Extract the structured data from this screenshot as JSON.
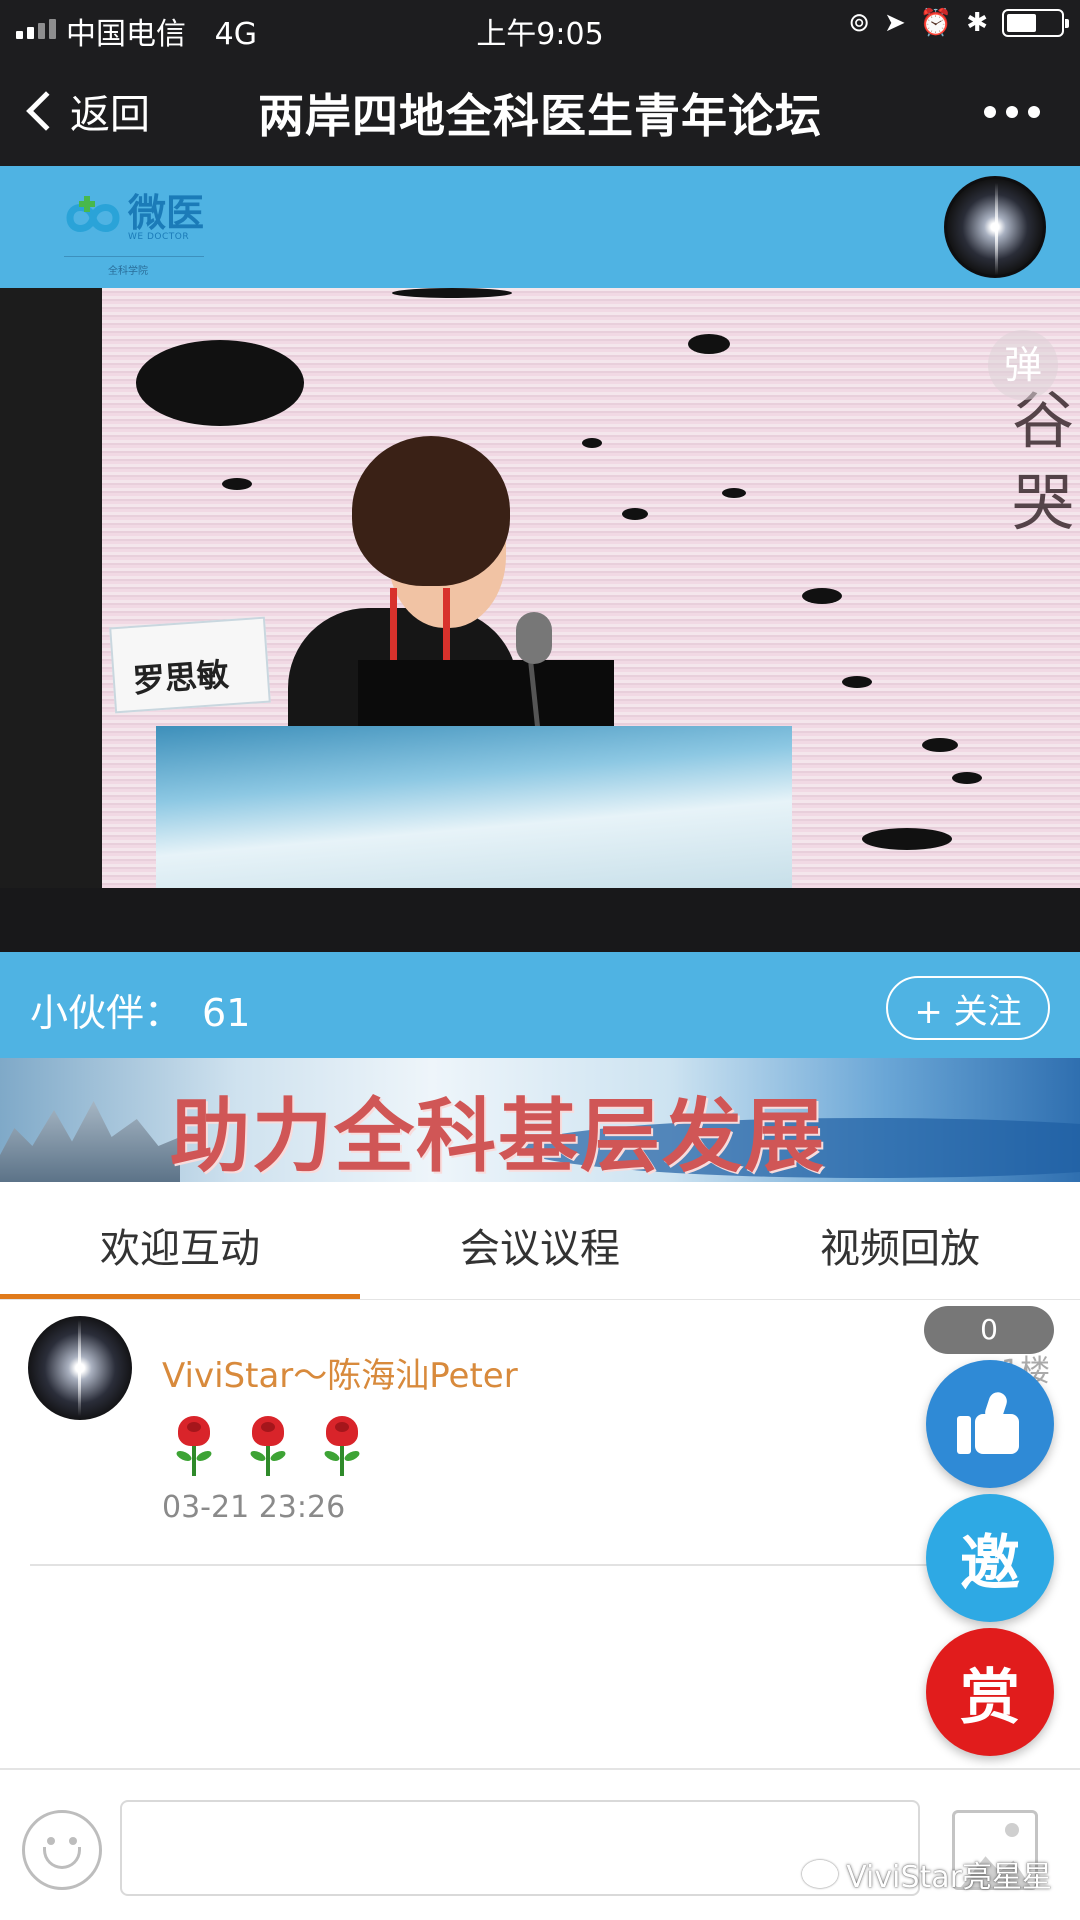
{
  "status_bar": {
    "carrier": "中国电信",
    "network": "4G",
    "time": "上午9:05",
    "battery_level": 0.55
  },
  "nav": {
    "back_label": "返回",
    "title": "两岸四地全科医生青年论坛"
  },
  "brand": {
    "name": "微医",
    "name_en": "WE DOCTOR",
    "subtitle": "全科学院",
    "colors": {
      "band": "#4fb3e3",
      "dark": "#1d1d1f",
      "accent": "#e07a1b"
    }
  },
  "video": {
    "nameplate": "罗思敏",
    "danmu_label": "弹"
  },
  "partners": {
    "label": "小伙伴：",
    "count": "61",
    "follow_label": "+ 关注"
  },
  "banner": {
    "slogan": "助力全科基层发展"
  },
  "tabs": [
    {
      "label": "欢迎互动",
      "active": true
    },
    {
      "label": "会议议程",
      "active": false
    },
    {
      "label": "视频回放",
      "active": false
    }
  ],
  "comment": {
    "author": "ViviStar～陈海汕Peter",
    "floor": "1楼",
    "roses": 3,
    "time": "03-21 23:26"
  },
  "actions": {
    "like_count": "0",
    "invite_label": "邀",
    "reward_label": "赏"
  },
  "input": {
    "placeholder": ""
  },
  "watermark": {
    "text": "ViviStar亮星星"
  }
}
